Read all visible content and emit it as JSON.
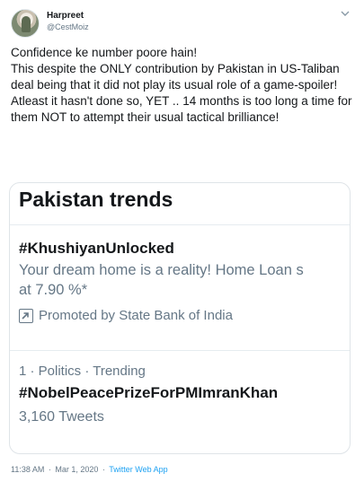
{
  "author": {
    "display_name": "Harpreet",
    "handle": "@CestMoiz"
  },
  "icons": {
    "caret": "chevron-down-icon",
    "promoted": "promoted-arrow-icon"
  },
  "tweet": {
    "lines": [
      "Confidence ke number poore hain!",
      "This despite the ONLY contribution by Pakistan in US-Taliban deal being that it did not play its usual role of a game-spoiler!",
      "Atleast it hasn't done so, YET .. 14 months is too long a time for them NOT to attempt their usual tactical brilliance!"
    ]
  },
  "card": {
    "title": "Pakistan trends",
    "promoted_trend": {
      "hashtag": "#KhushiyanUnlocked",
      "description": "Your dream home is a reality! Home Loan s",
      "description_2": "at 7.90 %*",
      "promoted_by": "Promoted by State Bank of India"
    },
    "trend": {
      "meta": "1 · Politics · Trending",
      "hashtag": "#NobelPeacePrizeForPMImranKhan",
      "count": "3,160 Tweets"
    }
  },
  "footer": {
    "time": "11:38 AM",
    "date": "Mar 1, 2020",
    "separator": "·",
    "source": "Twitter Web App"
  },
  "colors": {
    "text": "#14171a",
    "secondary": "#657786",
    "link": "#1da1f2",
    "border": "#dfe4e8"
  }
}
